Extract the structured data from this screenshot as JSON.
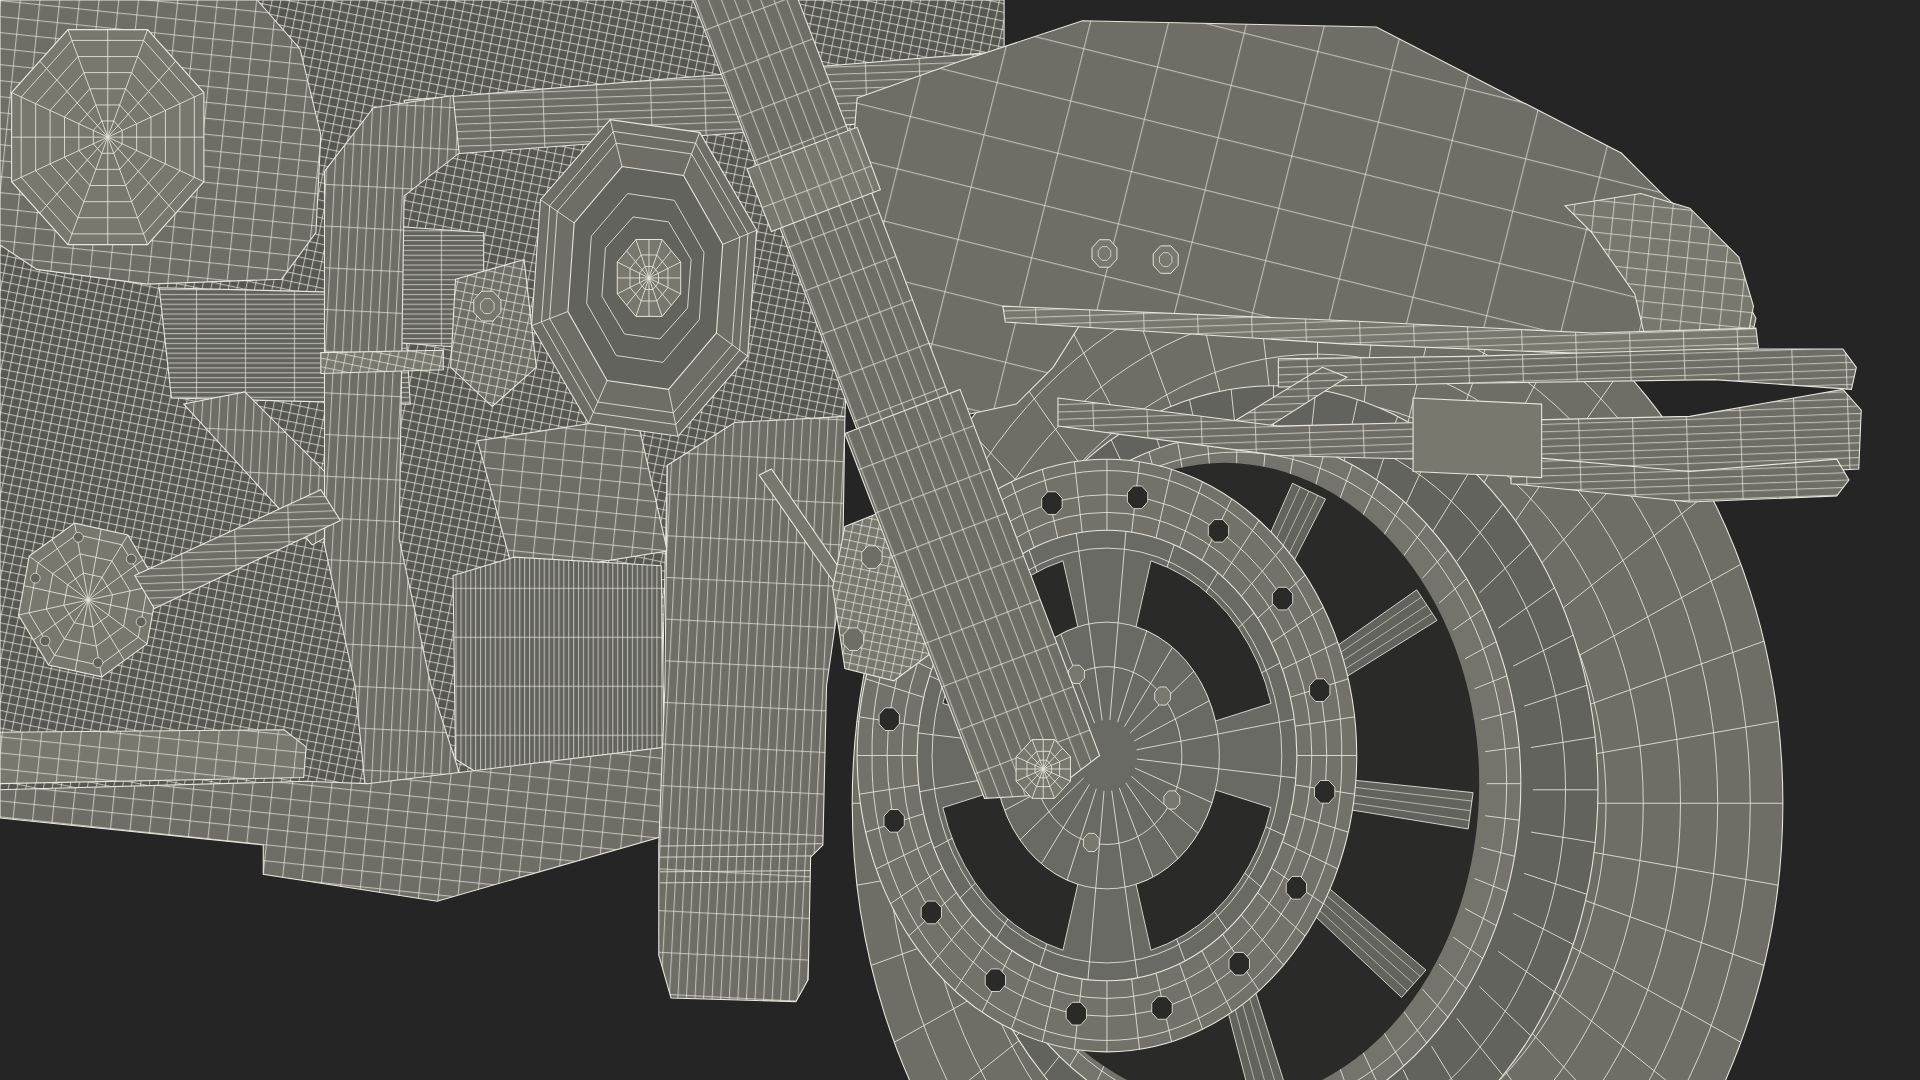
{
  "scene": {
    "wireframe": true
  }
}
